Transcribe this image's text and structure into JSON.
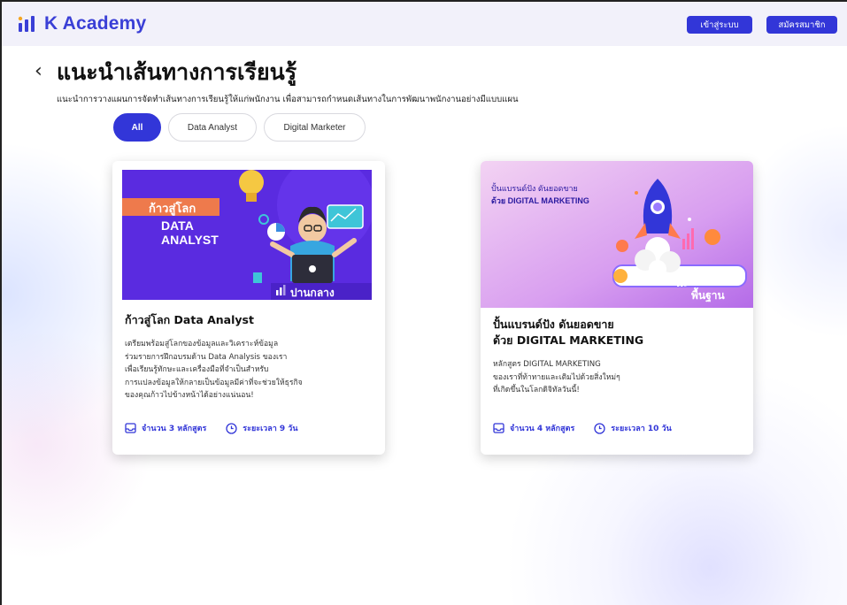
{
  "header": {
    "logo_text": "K Academy",
    "login_label": "เข้าสู่ระบบ",
    "signup_label": "สมัครสมาชิก",
    "brand_color": "#3236d8"
  },
  "page": {
    "back_glyph": "‹",
    "title": "แนะนำเส้นทางการเรียนรู้",
    "subtitle": "แนะนำการวางแผนการจัดทำเส้นทางการเรียนรู้ให้แก่พนักงาน เพื่อสามารถกำหนดเส้นทางในการพัฒนาพนักงานอย่างมีแบบแผน"
  },
  "filters": [
    {
      "label": "All",
      "active": true
    },
    {
      "label": "Data Analyst",
      "active": false
    },
    {
      "label": "Digital Marketer",
      "active": false
    }
  ],
  "cards": [
    {
      "image": {
        "tag": "ก้าวสู่โลก",
        "line1": "DATA",
        "line2": "ANALYST",
        "level": "ปานกลาง"
      },
      "title": "ก้าวสู่โลก Data Analyst",
      "description": [
        "เตรียมพร้อมสู่โลกของข้อมูลและวิเคราะห์ข้อมูล",
        "ร่วมรายการฝึกอบรมด้าน Data Analysis ของเรา",
        "เพื่อเรียนรู้ทักษะและเครื่องมือที่จำเป็นสำหรับ",
        "การแปลงข้อมูลให้กลายเป็นข้อมูลมีค่าที่จะช่วยให้ธุรกิจ",
        "ของคุณก้าวไปข้างหน้าได้อย่างแน่นอน!"
      ],
      "courses": "จำนวน 3 หลักสูตร",
      "duration": "ระยะเวลา 9 วัน"
    },
    {
      "image": {
        "line1": "ปั้นแบรนด์ปัง ดันยอดขาย",
        "line2": "ด้วย DIGITAL MARKETING",
        "level": "พื้นฐาน"
      },
      "title_line1": "ปั้นแบรนด์ปัง ดันยอดขาย",
      "title_line2": "ด้วย DIGITAL MARKETING",
      "description": [
        "หลักสูตร DIGITAL MARKETING",
        "ของเราที่ท้าทายและเติมไปด้วยสิ่งใหม่ๆ",
        "ที่เกิดขึ้นในโลกดิจิทัลวันนี้!"
      ],
      "courses": "จำนวน 4 หลักสูตร",
      "duration": "ระยะเวลา 10 วัน"
    }
  ]
}
